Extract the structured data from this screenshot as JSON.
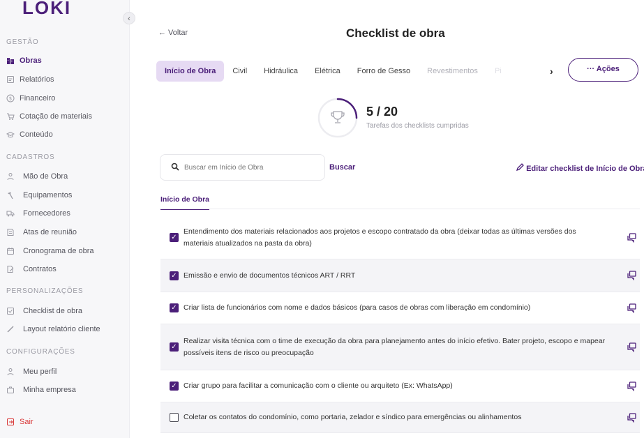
{
  "sidebar": {
    "logo": "LOKI",
    "collapse_icon": "‹",
    "sections": [
      {
        "title": "GESTÃO",
        "items": [
          {
            "label": "Obras",
            "icon": "building-icon",
            "active": true
          },
          {
            "label": "Relatórios",
            "icon": "report-icon"
          },
          {
            "label": "Financeiro",
            "icon": "dollar-icon"
          },
          {
            "label": "Cotação de materiais",
            "icon": "cart-icon"
          },
          {
            "label": "Conteúdo",
            "icon": "graduation-icon"
          }
        ]
      },
      {
        "title": "CADASTROS",
        "items": [
          {
            "label": "Mão de Obra",
            "icon": "person-icon"
          },
          {
            "label": "Equipamentos",
            "icon": "hammer-icon"
          },
          {
            "label": "Fornecedores",
            "icon": "truck-icon"
          },
          {
            "label": "Atas de reunião",
            "icon": "minutes-icon"
          },
          {
            "label": "Cronograma de obra",
            "icon": "calendar-icon"
          },
          {
            "label": "Contratos",
            "icon": "contract-icon"
          }
        ]
      },
      {
        "title": "PERSONALIZAÇÕES",
        "items": [
          {
            "label": "Checklist de obra",
            "icon": "checklist-icon"
          },
          {
            "label": "Layout relatório cliente",
            "icon": "brush-icon"
          }
        ]
      },
      {
        "title": "CONFIGURAÇÕES",
        "items": [
          {
            "label": "Meu perfil",
            "icon": "person-icon"
          },
          {
            "label": "Minha empresa",
            "icon": "briefcase-icon"
          }
        ]
      }
    ],
    "logout": "Sair"
  },
  "header": {
    "back": "← Voltar",
    "title": "Checklist de obra"
  },
  "tabs": [
    {
      "label": "Início de Obra",
      "active": true
    },
    {
      "label": "Civil"
    },
    {
      "label": "Hidráulica"
    },
    {
      "label": "Elétrica"
    },
    {
      "label": "Forro de Gesso"
    },
    {
      "label": "Revestimentos",
      "faded": true
    },
    {
      "label": "Pi",
      "faded": true
    }
  ],
  "tabs_next_icon": "›",
  "actions_button": "··· Ações",
  "progress": {
    "count": "5 / 20",
    "done": 5,
    "total": 20,
    "caption": "Tarefas dos checklists cumpridas"
  },
  "search": {
    "placeholder": "Buscar em Início de Obra",
    "button": "Buscar"
  },
  "edit_link": "Editar checklist de Início de Obra",
  "section_tab": "Início de Obra",
  "colors": {
    "accent": "#4b1f79",
    "accent_light": "#e6daf3",
    "logout": "#d93838"
  },
  "checklist": [
    {
      "text": "Entendimento dos materiais relacionados aos projetos e escopo contratado da obra (deixar todas as últimas versões dos materiais atualizados na pasta da obra)",
      "checked": true
    },
    {
      "text": "Emissão e envio de documentos técnicos ART / RRT",
      "checked": true
    },
    {
      "text": "Criar lista de funcionários com nome e dados básicos (para casos de obras com liberação em condomínio)",
      "checked": true
    },
    {
      "text": "Realizar visita técnica com o time de execução da obra para planejamento antes do início efetivo. Bater projeto, escopo e mapear possíveis itens de risco ou preocupação",
      "checked": true
    },
    {
      "text": "Criar grupo para facilitar a comunicação com o cliente ou arquiteto (Ex: WhatsApp)",
      "checked": true
    },
    {
      "text": "Coletar os contatos do condomínio, como portaria, zelador e síndico para emergências ou alinhamentos",
      "checked": false
    }
  ]
}
